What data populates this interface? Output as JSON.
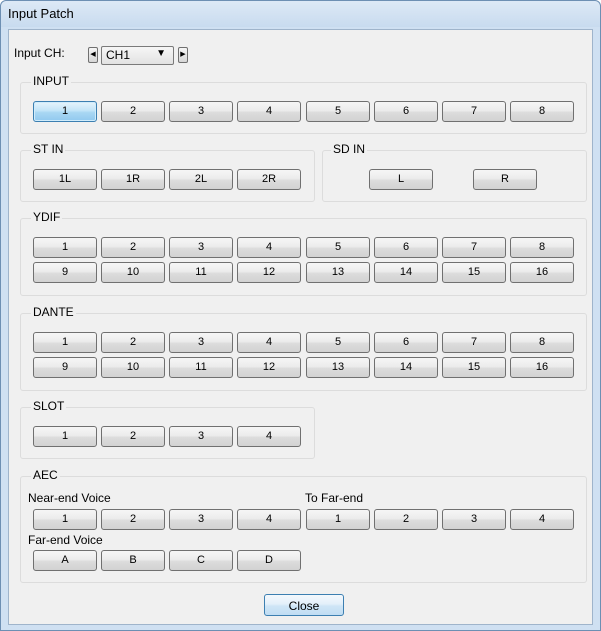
{
  "window": {
    "title": "Input Patch"
  },
  "input_ch": {
    "label": "Input CH:",
    "selected": "CH1",
    "prev_glyph": "◀",
    "next_glyph": "▶",
    "caret": "▼"
  },
  "input": {
    "label": "INPUT",
    "buttons": [
      "1",
      "2",
      "3",
      "4",
      "5",
      "6",
      "7",
      "8"
    ],
    "active_index": 0
  },
  "st_in": {
    "label": "ST IN",
    "buttons": [
      "1L",
      "1R",
      "2L",
      "2R"
    ]
  },
  "sd_in": {
    "label": "SD IN",
    "buttons": [
      "L",
      "R"
    ]
  },
  "ydif": {
    "label": "YDIF",
    "row1": [
      "1",
      "2",
      "3",
      "4",
      "5",
      "6",
      "7",
      "8"
    ],
    "row2": [
      "9",
      "10",
      "11",
      "12",
      "13",
      "14",
      "15",
      "16"
    ]
  },
  "dante": {
    "label": "DANTE",
    "row1": [
      "1",
      "2",
      "3",
      "4",
      "5",
      "6",
      "7",
      "8"
    ],
    "row2": [
      "9",
      "10",
      "11",
      "12",
      "13",
      "14",
      "15",
      "16"
    ]
  },
  "slot": {
    "label": "SLOT",
    "buttons": [
      "1",
      "2",
      "3",
      "4"
    ]
  },
  "aec": {
    "label": "AEC",
    "near_end_label": "Near-end Voice",
    "near_end": [
      "1",
      "2",
      "3",
      "4"
    ],
    "far_end_label": "To Far-end",
    "far_end": [
      "1",
      "2",
      "3",
      "4"
    ],
    "far_voice_label": "Far-end Voice",
    "far_voice": [
      "A",
      "B",
      "C",
      "D"
    ]
  },
  "footer": {
    "close_label": "Close"
  }
}
